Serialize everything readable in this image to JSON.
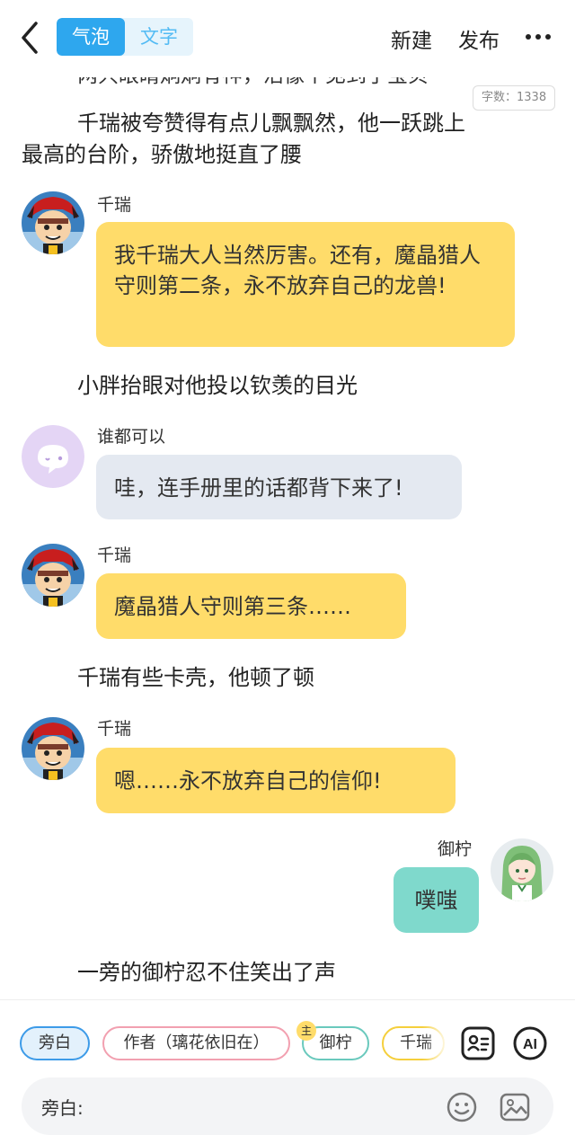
{
  "header": {
    "mode_bubble": "气泡",
    "mode_text": "文字",
    "new_label": "新建",
    "publish_label": "发布"
  },
  "story": {
    "clipped_line": "两只眼睛炯炯有神，活像个见到了宝贝",
    "word_count_label": "字数：",
    "word_count": "1338",
    "narration_1_line1": "千瑞被夸赞得有点儿飘飘然，他一跃跳上",
    "narration_1_line2": "最高的台阶，骄傲地挺直了腰",
    "msg_1_sender": "千瑞",
    "msg_1_text": "我千瑞大人当然厉害。还有，魔晶猎人守则第二条，永不放弃自己的龙兽!",
    "narration_2": "小胖抬眼对他投以钦羡的目光",
    "msg_2_sender": "谁都可以",
    "msg_2_text": "哇，连手册里的话都背下来了!",
    "msg_3_sender": "千瑞",
    "msg_3_text": "魔晶猎人守则第三条……",
    "narration_3": "千瑞有些卡壳，他顿了顿",
    "msg_4_sender": "千瑞",
    "msg_4_text": "嗯……永不放弃自己的信仰!",
    "msg_5_sender": "御柠",
    "msg_5_text": "噗嗤",
    "narration_4": "一旁的御柠忍不住笑出了声"
  },
  "roles": {
    "narrator": "旁白",
    "author": "作者（璃花依旧在）",
    "main_badge": "主",
    "yuning": "御柠",
    "qianrui": "千瑞"
  },
  "input": {
    "label": "旁白:",
    "placeholder": ""
  },
  "tools": {
    "ai_label": "AI"
  },
  "colors": {
    "accent": "#2ea7ee",
    "qianrui_bubble": "#ffdc6a",
    "anyone_bubble": "#e4e9f1",
    "yuning_bubble": "#7fd9cc"
  }
}
